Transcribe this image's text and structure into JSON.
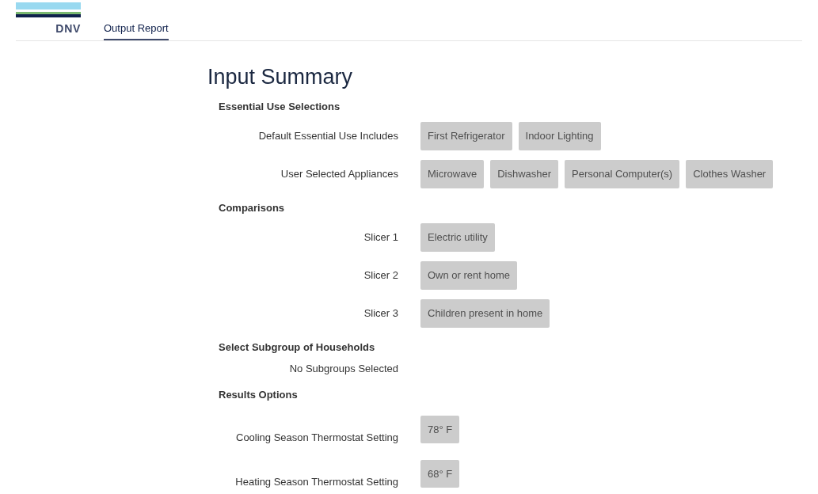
{
  "header": {
    "logo_text": "DNV",
    "tabs": [
      {
        "label": "Output Report",
        "selected": true
      }
    ]
  },
  "title": "Input Summary",
  "sections": [
    {
      "heading": "Essential Use Selections",
      "rows": [
        {
          "kind": "chips",
          "label": "Default Essential Use Includes",
          "chips": [
            "First Refrigerator",
            "Indoor Lighting"
          ]
        },
        {
          "kind": "chips",
          "label": "User Selected Appliances",
          "chips": [
            "Microwave",
            "Dishwasher",
            "Personal Computer(s)",
            "Clothes Washer"
          ]
        }
      ]
    },
    {
      "heading": "Comparisons",
      "rows": [
        {
          "kind": "chips",
          "label": "Slicer 1",
          "chips": [
            "Electric utility"
          ]
        },
        {
          "kind": "chips",
          "label": "Slicer 2",
          "chips": [
            "Own or rent home"
          ]
        },
        {
          "kind": "chips",
          "label": "Slicer 3",
          "chips": [
            "Children present in home"
          ]
        }
      ]
    },
    {
      "heading": "Select Subgroup of Households",
      "rows": [
        {
          "kind": "note",
          "label": "No Subgroups Selected"
        }
      ]
    },
    {
      "heading": "Results Options",
      "rows": [
        {
          "kind": "setting",
          "label": "Cooling Season Thermostat Setting",
          "chips": [
            "78° F"
          ]
        },
        {
          "kind": "setting",
          "label": "Heating Season Thermostat Setting",
          "chips": [
            "68° F"
          ]
        }
      ]
    }
  ]
}
